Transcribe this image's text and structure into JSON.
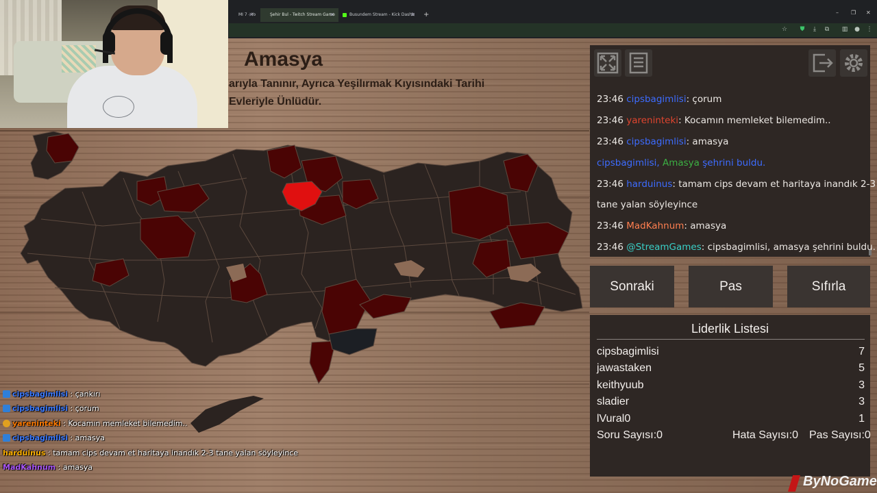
{
  "browser": {
    "tabs": [
      {
        "label": "MI 7 - Yo"
      },
      {
        "label": "Şehir Bul - Twitch Stream Game"
      },
      {
        "label": "Busundem Stream - Kick Dashb"
      }
    ],
    "new_tab": "+",
    "window": {
      "minimize": "–",
      "maximize": "❐",
      "close": "✕"
    }
  },
  "game": {
    "city_name": "Amasya",
    "city_description": "arıyla Tanınır, Ayrıca Yeşilırmak Kıyısındaki Tarihi\nEvleriyle Ünlüdür.",
    "toolbar": {
      "fullscreen_icon": "expand-icon",
      "list_icon": "document-icon",
      "exit_icon": "exit-icon",
      "settings_icon": "gear-icon"
    },
    "chat": [
      {
        "time": "23:46",
        "user": "cipsbagimlisi",
        "user_color": "#3d6cff",
        "text": ": çorum"
      },
      {
        "time": "23:46",
        "user": "yareninteki",
        "user_color": "#e0452f",
        "text": ": Kocamın memleket bilemedim.."
      },
      {
        "time": "23:46",
        "user": "cipsbagimlisi",
        "user_color": "#3d6cff",
        "text": ": amasya"
      },
      {
        "time": "",
        "user": "cipsbagimlisi",
        "user_color": "#3d6cff",
        "text_parts": [
          ", ",
          "Amasya",
          " şehrini buldu."
        ],
        "highlight_color": "#3cb043",
        "tail_color": "#3d6cff"
      },
      {
        "time": "23:46",
        "user": "harduinus",
        "user_color": "#3d6cff",
        "text": ": tamam cips devam et haritaya inandık 2-3"
      },
      {
        "time": "",
        "user": "",
        "text": "tane yalan söyleyince"
      },
      {
        "time": "23:46",
        "user": "MadKahnum",
        "user_color": "#ff7f50",
        "text": ": amasya"
      },
      {
        "time": "23:46",
        "user": "@StreamGames",
        "user_color": "#39d0c8",
        "text": ": cipsbagimlisi, amasya şehrini buldu."
      }
    ],
    "buttons": {
      "next": "Sonraki",
      "pass": "Pas",
      "reset": "Sıfırla"
    },
    "leaderboard": {
      "title": "Liderlik Listesi",
      "rows": [
        {
          "name": "cipsbagimlisi",
          "score": "7"
        },
        {
          "name": "jawastaken",
          "score": "5"
        },
        {
          "name": "keithyuub",
          "score": "3"
        },
        {
          "name": "sladier",
          "score": "3"
        },
        {
          "name": "lVural0",
          "score": "1"
        }
      ],
      "question_count": "Soru Sayısı:0",
      "error_count": "Hata Sayısı:0",
      "pass_count": "Pas Sayısı:0"
    }
  },
  "overlay_chat": [
    {
      "user": "cipsbagimlisi",
      "user_color": "#3d7bff",
      "text": " : çankırı",
      "badge_color": "#2f7fd8"
    },
    {
      "user": "cipsbagimlisi",
      "user_color": "#3d7bff",
      "text": " : çorum",
      "badge_color": "#2f7fd8"
    },
    {
      "user": "yareninteki",
      "user_color": "#ff7a00",
      "text": " : Kocamın memleket bilemedim..",
      "badge_color": "#e0a020"
    },
    {
      "user": "cipsbagimlisi",
      "user_color": "#3d7bff",
      "text": " : amasya",
      "badge_color": "#2f7fd8"
    },
    {
      "user": "harduinus",
      "user_color": "#ffb000",
      "text": " : tamam cips devam et haritaya inandık 2-3 tane yalan söyleyince",
      "badge_color": ""
    },
    {
      "user": "MadKahnum",
      "user_color": "#a855f7",
      "text": " : amasya",
      "badge_color": ""
    }
  ],
  "watermark": "ByNoGame",
  "colors": {
    "found_province": "#4a0404",
    "current_province": "#e01010",
    "province": "#2b2320",
    "panel": "#2e2724"
  }
}
